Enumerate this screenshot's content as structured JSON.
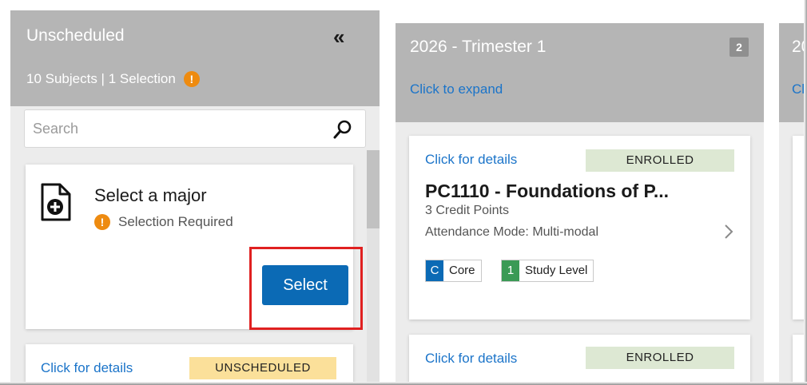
{
  "unscheduled": {
    "title": "Unscheduled",
    "summary": "10 Subjects | 1 Selection",
    "warning_glyph": "!",
    "search": {
      "placeholder": "Search"
    },
    "major_card": {
      "title": "Select a major",
      "requirement": "Selection Required",
      "select_label": "Select",
      "icon": "document-plus-icon"
    },
    "next_card": {
      "details_link": "Click for details",
      "status": "UNSCHEDULED"
    }
  },
  "trimester": {
    "title": "2026 - Trimester 1",
    "count": "2",
    "expand_link": "Click to expand",
    "subjects": [
      {
        "details_link": "Click for details",
        "status": "ENROLLED",
        "title": "PC1110 - Foundations of P...",
        "credit": "3 Credit Points",
        "attendance": "Attendance Mode: Multi-modal",
        "tags": [
          {
            "code": "C",
            "label": "Core"
          },
          {
            "code": "1",
            "label": "Study Level"
          }
        ]
      },
      {
        "details_link": "Click for details",
        "status": "ENROLLED"
      }
    ]
  },
  "next_column": {
    "title_partial": "20",
    "link_partial": "Cl"
  },
  "colors": {
    "header_gray": "#b5b5b5",
    "column_bg": "#ececec",
    "link_blue": "#1b74c9",
    "primary_button": "#0b6ab5",
    "warning_orange": "#ee8b10",
    "enrolled_bg": "#dde8d3",
    "unscheduled_bg": "#fbe09a",
    "highlight_red": "#e02020",
    "core_tag": "#0b6ab5",
    "level_tag": "#3a9a55"
  }
}
